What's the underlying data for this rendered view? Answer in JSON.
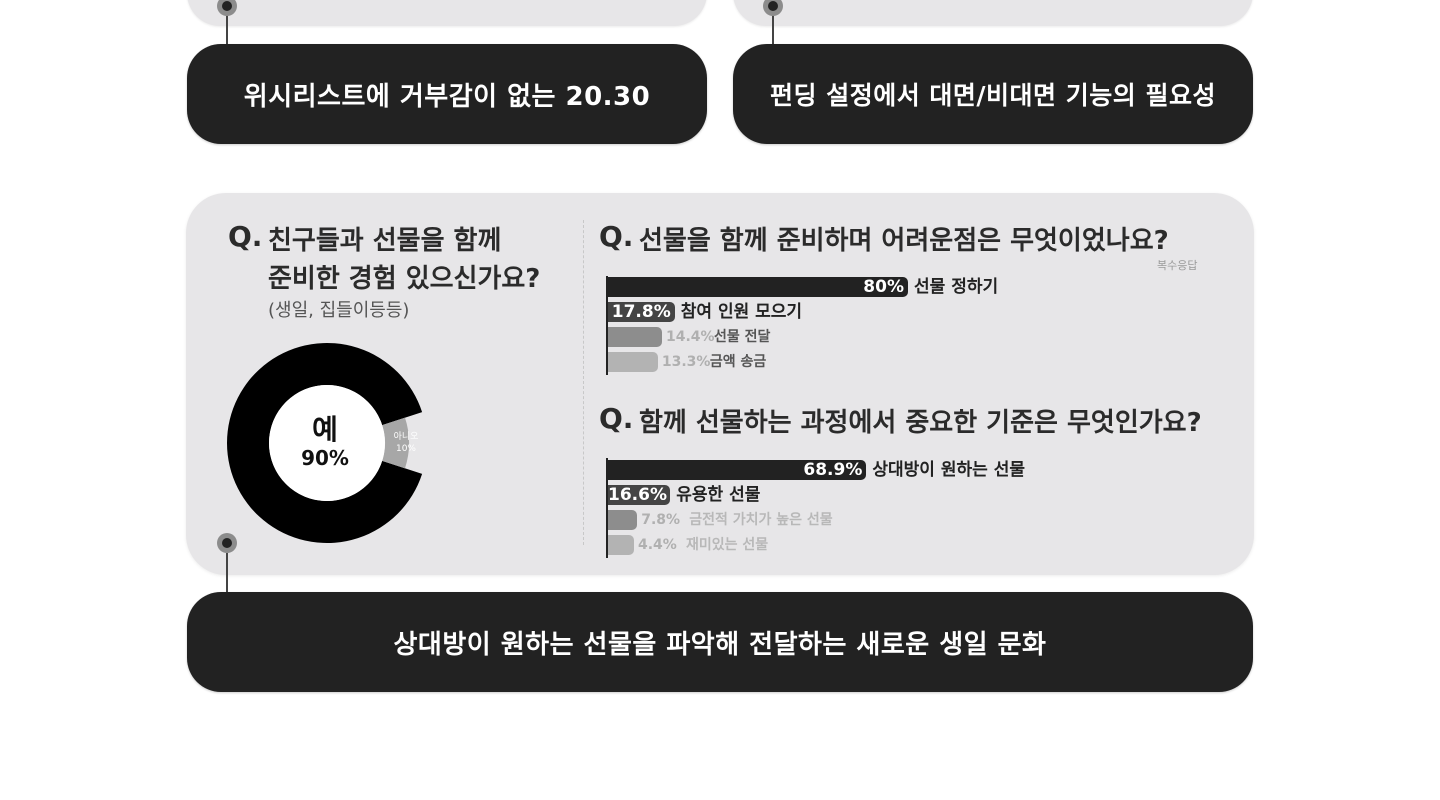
{
  "summaries": {
    "left": "위시리스트에 거부감이 없는 20.30",
    "right": "펀딩 설정에서 대면/비대면 기능의 필요성",
    "bottom": "상대방이 원하는 선물을 파악해 전달하는 새로운 생일 문화"
  },
  "survey": {
    "q_mark": "Q.",
    "q1_line1": "친구들과 선물을 함께",
    "q1_line2": "준비한 경험 있으신가요?",
    "q1_sub": "(생일, 집들이등등)",
    "q2": "선물을 함께 준비하며 어려운점은 무엇이었나요?",
    "q2_note": "복수응답",
    "q3": "함께 선물하는 과정에서 중요한 기준은 무엇인가요?"
  },
  "chart_data": [
    {
      "type": "pie",
      "labels": [
        "예",
        "아니오"
      ],
      "values": [
        90,
        10
      ],
      "value_labels": [
        "90%",
        "10%"
      ],
      "colors": [
        "#000000",
        "#a7a7a7"
      ]
    },
    {
      "type": "bar",
      "orientation": "horizontal",
      "categories": [
        "선물 정하기",
        "참여 인원 모으기",
        "선물 전달",
        "금액 송금"
      ],
      "values": [
        80,
        17.8,
        14.4,
        13.3
      ],
      "value_labels": [
        "80%",
        "17.8%",
        "14.4%",
        "13.3%"
      ],
      "colors": [
        "#222222",
        "#444444",
        "#8d8d8d",
        "#b3b3b3"
      ],
      "xlim": [
        0,
        100
      ]
    },
    {
      "type": "bar",
      "orientation": "horizontal",
      "categories": [
        "상대방이 원하는 선물",
        "유용한 선물",
        "금전적 가치가 높은 선물",
        "재미있는 선물"
      ],
      "values": [
        68.9,
        16.6,
        7.8,
        4.4
      ],
      "value_labels": [
        "68.9%",
        "16.6%",
        "7.8%",
        "4.4%"
      ],
      "colors": [
        "#222222",
        "#444444",
        "#8d8d8d",
        "#b3b3b3"
      ],
      "xlim": [
        0,
        100
      ]
    }
  ]
}
